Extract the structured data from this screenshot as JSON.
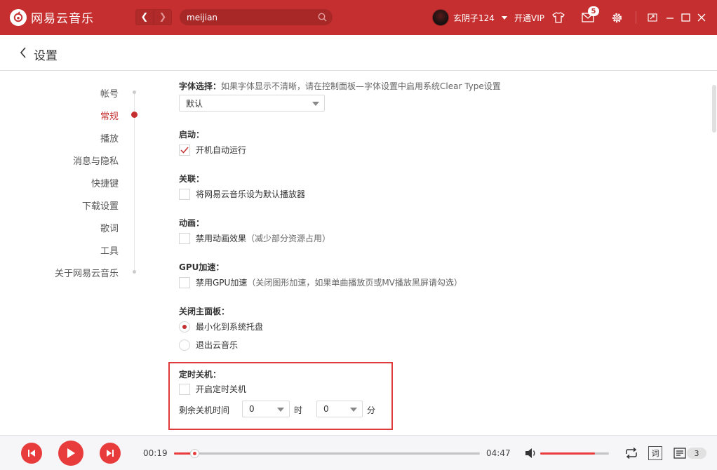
{
  "app": {
    "name": "网易云音乐",
    "colors": {
      "brand": "#c62f2f",
      "accent": "#e83c3c"
    }
  },
  "titlebar": {
    "search": {
      "value": "meijian",
      "icon": "search-icon"
    },
    "user": {
      "name": "玄阴子124"
    },
    "vip_label": "开通VIP",
    "messages_badge": "5"
  },
  "page": {
    "title": "设置"
  },
  "sidebar": {
    "items": [
      {
        "label": "帐号"
      },
      {
        "label": "常规"
      },
      {
        "label": "播放"
      },
      {
        "label": "消息与隐私"
      },
      {
        "label": "快捷键"
      },
      {
        "label": "下载设置"
      },
      {
        "label": "歌词"
      },
      {
        "label": "工具"
      },
      {
        "label": "关于网易云音乐"
      }
    ],
    "active": "常规"
  },
  "settings": {
    "font": {
      "label": "字体选择：",
      "hint": "如果字体显示不清晰，请在控制面板—字体设置中启用系统Clear Type设置",
      "selected": "默认"
    },
    "startup": {
      "label": "启动：",
      "option": "开机自动运行",
      "checked": true
    },
    "association": {
      "label": "关联：",
      "option": "将网易云音乐设为默认播放器",
      "checked": false
    },
    "animation": {
      "label": "动画：",
      "option": "禁用动画效果",
      "note": "（减少部分资源占用）",
      "checked": false
    },
    "gpu": {
      "label": "GPU加速：",
      "option": "禁用GPU加速",
      "note": "（关闭图形加速，如果单曲播放页或MV播放黑屏请勾选）",
      "checked": false
    },
    "close_panel": {
      "label": "关闭主面板：",
      "options": [
        {
          "label": "最小化到系统托盘",
          "selected": true
        },
        {
          "label": "退出云音乐",
          "selected": false
        }
      ]
    },
    "timer": {
      "label": "定时关机：",
      "option": "开启定时关机",
      "checked": false,
      "remaining_label": "剩余关机时间",
      "hours": "0",
      "hour_unit": "时",
      "minutes": "0",
      "minute_unit": "分"
    }
  },
  "player": {
    "elapsed": "00:19",
    "duration": "04:47",
    "progress": 0.066,
    "volume": 0.8,
    "lyric_label": "词",
    "playlist_count": "3"
  }
}
